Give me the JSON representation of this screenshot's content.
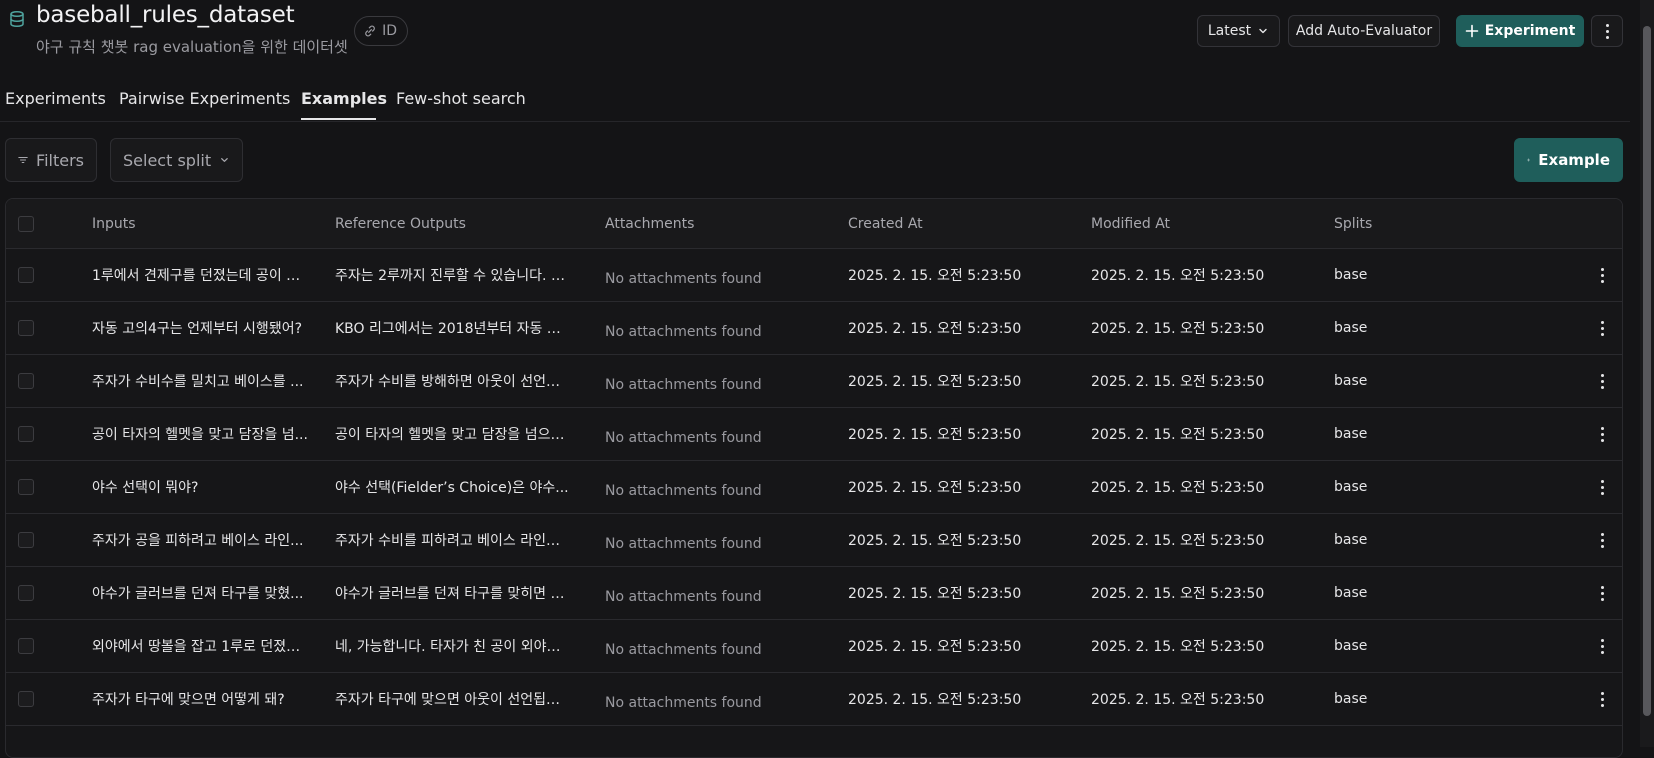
{
  "header": {
    "title": "baseball_rules_dataset",
    "subtitle": "야구 규칙 챗봇 rag evaluation을 위한 데이터셋",
    "id_label": "ID",
    "version_label": "Latest",
    "add_evaluator_label": "Add Auto-Evaluator",
    "experiment_label": "Experiment"
  },
  "tabs": [
    "Experiments",
    "Pairwise Experiments",
    "Examples",
    "Few-shot search"
  ],
  "active_tab": "Examples",
  "toolbar": {
    "filters_label": "Filters",
    "split_placeholder": "Select split",
    "add_example_label": "Example"
  },
  "table": {
    "columns": [
      "Inputs",
      "Reference Outputs",
      "Attachments",
      "Created At",
      "Modified At",
      "Splits"
    ],
    "rows": [
      {
        "input": "1루에서 견제구를 던졌는데 공이 펜...",
        "reference": "주자는 2루까지 진루할 수 있습니다. 투...",
        "attachments": "No attachments found",
        "created": "2025. 2. 15. 오전 5:23:50",
        "modified": "2025. 2. 15. 오전 5:23:50",
        "split": "base"
      },
      {
        "input": "자동 고의4구는 언제부터 시행됐어?",
        "reference": "KBO 리그에서는 2018년부터 자동 고...",
        "attachments": "No attachments found",
        "created": "2025. 2. 15. 오전 5:23:50",
        "modified": "2025. 2. 15. 오전 5:23:50",
        "split": "base"
      },
      {
        "input": "주자가 수비수를 밀치고 베이스를 ...",
        "reference": "주자가 수비를 방해하면 아웃이 선언됩...",
        "attachments": "No attachments found",
        "created": "2025. 2. 15. 오전 5:23:50",
        "modified": "2025. 2. 15. 오전 5:23:50",
        "split": "base"
      },
      {
        "input": "공이 타자의 헬멧을 맞고 담장을 넘...",
        "reference": "공이 타자의 헬멧을 맞고 담장을 넘으면 ...",
        "attachments": "No attachments found",
        "created": "2025. 2. 15. 오전 5:23:50",
        "modified": "2025. 2. 15. 오전 5:23:50",
        "split": "base"
      },
      {
        "input": "야수 선택이 뭐야?",
        "reference": "야수 선택(Fielder’s Choice)은 야수...",
        "attachments": "No attachments found",
        "created": "2025. 2. 15. 오전 5:23:50",
        "modified": "2025. 2. 15. 오전 5:23:50",
        "split": "base"
      },
      {
        "input": "주자가 공을 피하려고 베이스 라인...",
        "reference": "주자가 수비를 피하려고 베이스 라인을 ...",
        "attachments": "No attachments found",
        "created": "2025. 2. 15. 오전 5:23:50",
        "modified": "2025. 2. 15. 오전 5:23:50",
        "split": "base"
      },
      {
        "input": "야수가 글러브를 던져 타구를 맞혔...",
        "reference": "야수가 글러브를 던져 타구를 맞히면 인...",
        "attachments": "No attachments found",
        "created": "2025. 2. 15. 오전 5:23:50",
        "modified": "2025. 2. 15. 오전 5:23:50",
        "split": "base"
      },
      {
        "input": "외야에서 땅볼을 잡고 1루로 던졌는...",
        "reference": "네, 가능합니다. 타자가 친 공이 외야로 ...",
        "attachments": "No attachments found",
        "created": "2025. 2. 15. 오전 5:23:50",
        "modified": "2025. 2. 15. 오전 5:23:50",
        "split": "base"
      },
      {
        "input": "주자가 타구에 맞으면 어떻게 돼?",
        "reference": "주자가 타구에 맞으면 아웃이 선언됩니...",
        "attachments": "No attachments found",
        "created": "2025. 2. 15. 오전 5:23:50",
        "modified": "2025. 2. 15. 오전 5:23:50",
        "split": "base"
      }
    ]
  },
  "colors": {
    "accent": "#1f5e5b",
    "background": "#141416",
    "border": "#2a2a2e"
  },
  "icons": {
    "dataset": "database-icon",
    "id": "link-icon",
    "dropdown": "chevron-down-icon",
    "add": "plus-icon",
    "menu": "kebab-icon",
    "filters": "filter-icon"
  }
}
